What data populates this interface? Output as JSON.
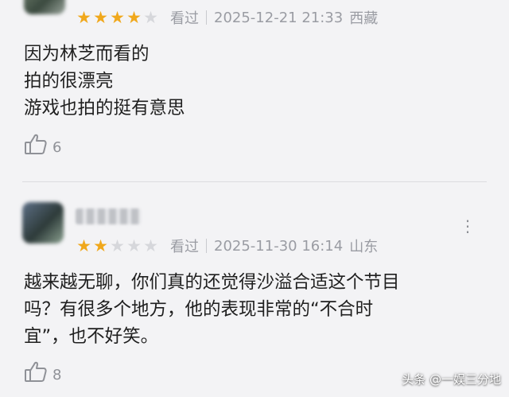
{
  "reviews": [
    {
      "rating": 4,
      "rating_max": 5,
      "status": "看过",
      "datetime": "2025-12-21 21:33",
      "location": "西藏",
      "lines": [
        "因为林芝而看的",
        "拍的很漂亮",
        "游戏也拍的挺有意思"
      ],
      "likes": "6"
    },
    {
      "rating": 2,
      "rating_max": 5,
      "status": "看过",
      "datetime": "2025-11-30 16:14",
      "location": "山东",
      "lines": [
        "越来越无聊，你们真的还觉得沙溢合适这个节目",
        "吗？有很多个地方，他的表现非常的“不合时",
        "宜”，也不好笑。"
      ],
      "likes": "8"
    }
  ],
  "icons": {
    "like": "thumbs-up-icon",
    "more": "more-dots-icon",
    "star": "star-icon"
  },
  "colors": {
    "star_on": "#f0a81c",
    "star_off": "#d6d7db",
    "meta_text": "#9a9ca3"
  },
  "watermark": "头条 @一娱三分地"
}
